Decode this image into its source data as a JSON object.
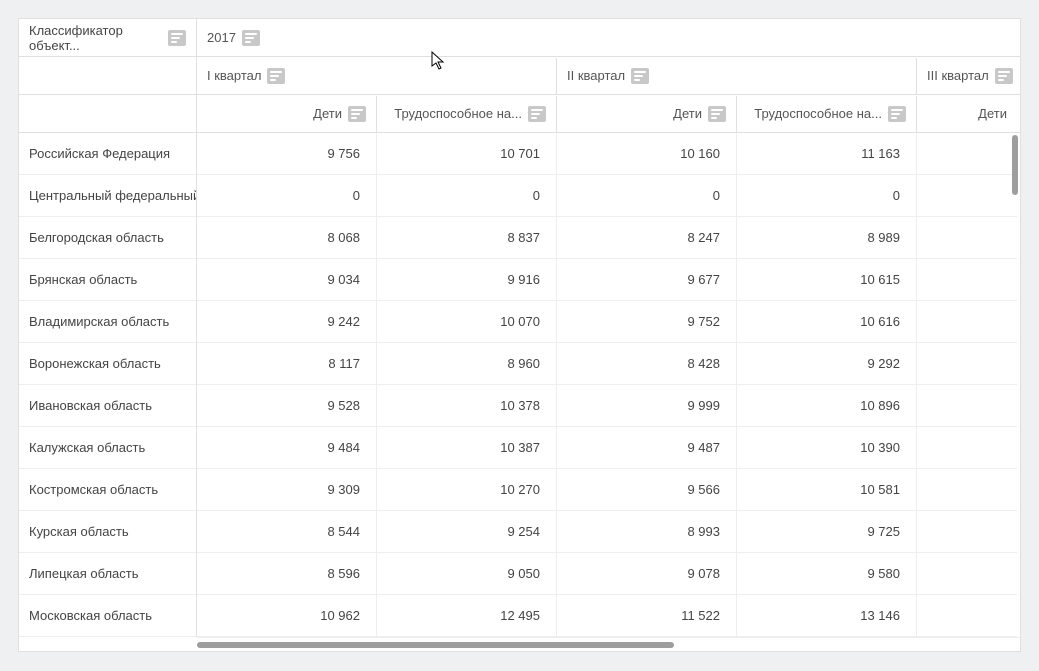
{
  "corner_label": "Классификатор объект...",
  "year_label": "2017",
  "quarters": [
    "I квартал",
    "II квартал",
    "III квартал"
  ],
  "col_labels": {
    "children": "Дети",
    "working": "Трудоспособное на..."
  },
  "rows": [
    {
      "name": "Российская Федерация",
      "q1c": "9 756",
      "q1w": "10 701",
      "q2c": "10 160",
      "q2w": "11 163",
      "q3c": ""
    },
    {
      "name": "Центральный федеральный...",
      "q1c": "0",
      "q1w": "0",
      "q2c": "0",
      "q2w": "0",
      "q3c": ""
    },
    {
      "name": "Белгородская область",
      "q1c": "8 068",
      "q1w": "8 837",
      "q2c": "8 247",
      "q2w": "8 989",
      "q3c": ""
    },
    {
      "name": "Брянская область",
      "q1c": "9 034",
      "q1w": "9 916",
      "q2c": "9 677",
      "q2w": "10 615",
      "q3c": ""
    },
    {
      "name": "Владимирская область",
      "q1c": "9 242",
      "q1w": "10 070",
      "q2c": "9 752",
      "q2w": "10 616",
      "q3c": ""
    },
    {
      "name": "Воронежская область",
      "q1c": "8 117",
      "q1w": "8 960",
      "q2c": "8 428",
      "q2w": "9 292",
      "q3c": ""
    },
    {
      "name": "Ивановская область",
      "q1c": "9 528",
      "q1w": "10 378",
      "q2c": "9 999",
      "q2w": "10 896",
      "q3c": ""
    },
    {
      "name": "Калужская область",
      "q1c": "9 484",
      "q1w": "10 387",
      "q2c": "9 487",
      "q2w": "10 390",
      "q3c": ""
    },
    {
      "name": "Костромская область",
      "q1c": "9 309",
      "q1w": "10 270",
      "q2c": "9 566",
      "q2w": "10 581",
      "q3c": ""
    },
    {
      "name": "Курская область",
      "q1c": "8 544",
      "q1w": "9 254",
      "q2c": "8 993",
      "q2w": "9 725",
      "q3c": ""
    },
    {
      "name": "Липецкая область",
      "q1c": "8 596",
      "q1w": "9 050",
      "q2c": "9 078",
      "q2w": "9 580",
      "q3c": ""
    },
    {
      "name": "Московская область",
      "q1c": "10 962",
      "q1w": "12 495",
      "q2c": "11 522",
      "q2w": "13 146",
      "q3c": ""
    }
  ]
}
